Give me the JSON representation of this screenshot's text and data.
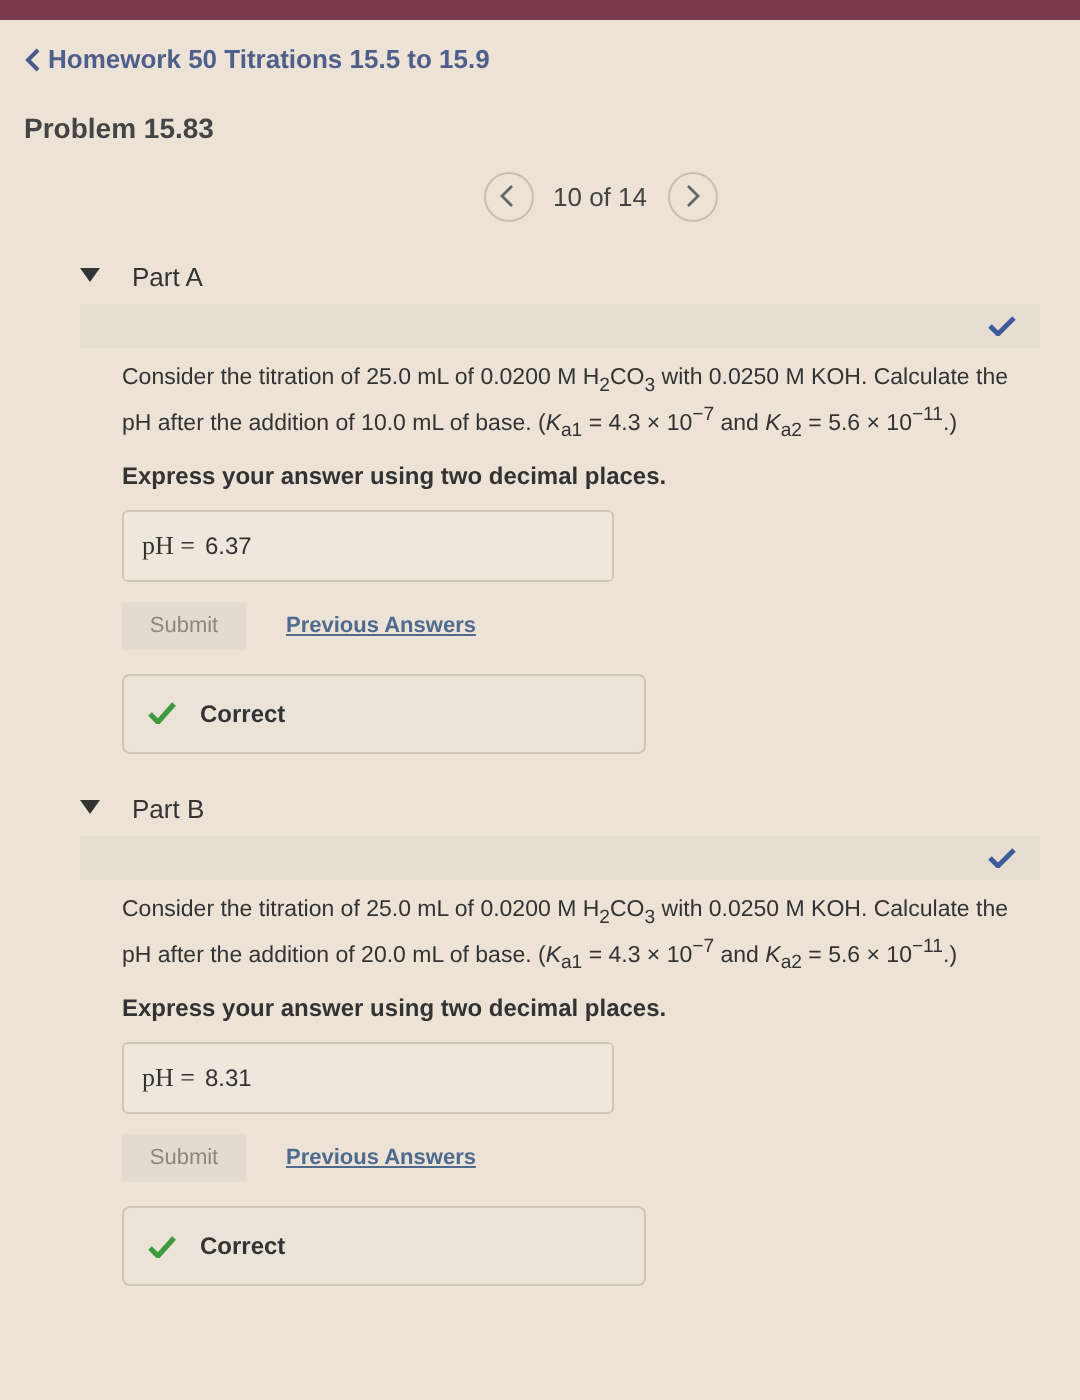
{
  "breadcrumb": "Homework 50 Titrations 15.5 to 15.9",
  "problem_title": "Problem 15.83",
  "pager": {
    "text": "10 of 14"
  },
  "parts": [
    {
      "title": "Part A",
      "expanded": true,
      "completed": true,
      "question": "Consider the titration of 25.0 mL of 0.0200 M H$_{2}$CO$_{3}$ with 0.0250 M KOH. Calculate the pH after the addition of 10.0 mL of base. (*K*$_{a1}$ = 4.3 × 10$^{−7}$ and *K*$_{a2}$ = 5.6 × 10$^{−11}$.)",
      "instruction": "Express your answer using two decimal places.",
      "answer": {
        "label": "pH =",
        "value": "6.37"
      },
      "submit": {
        "label": "Submit",
        "disabled": true
      },
      "link": "Previous Answers",
      "feedback": {
        "kind": "correct",
        "text": "Correct"
      }
    },
    {
      "title": "Part B",
      "expanded": true,
      "completed": true,
      "question": "Consider the titration of 25.0 mL of 0.0200 M H$_{2}$CO$_{3}$ with 0.0250 M KOH. Calculate the pH after the addition of 20.0 mL of base. (*K*$_{a1}$ = 4.3 × 10$^{−7}$ and *K*$_{a2}$ = 5.6 × 10$^{−11}$.)",
      "instruction": "Express your answer using two decimal places.",
      "answer": {
        "label": "pH =",
        "value": "8.31"
      },
      "submit": {
        "label": "Submit",
        "disabled": true
      },
      "link": "Previous Answers",
      "feedback": {
        "kind": "correct",
        "text": "Correct"
      }
    }
  ]
}
